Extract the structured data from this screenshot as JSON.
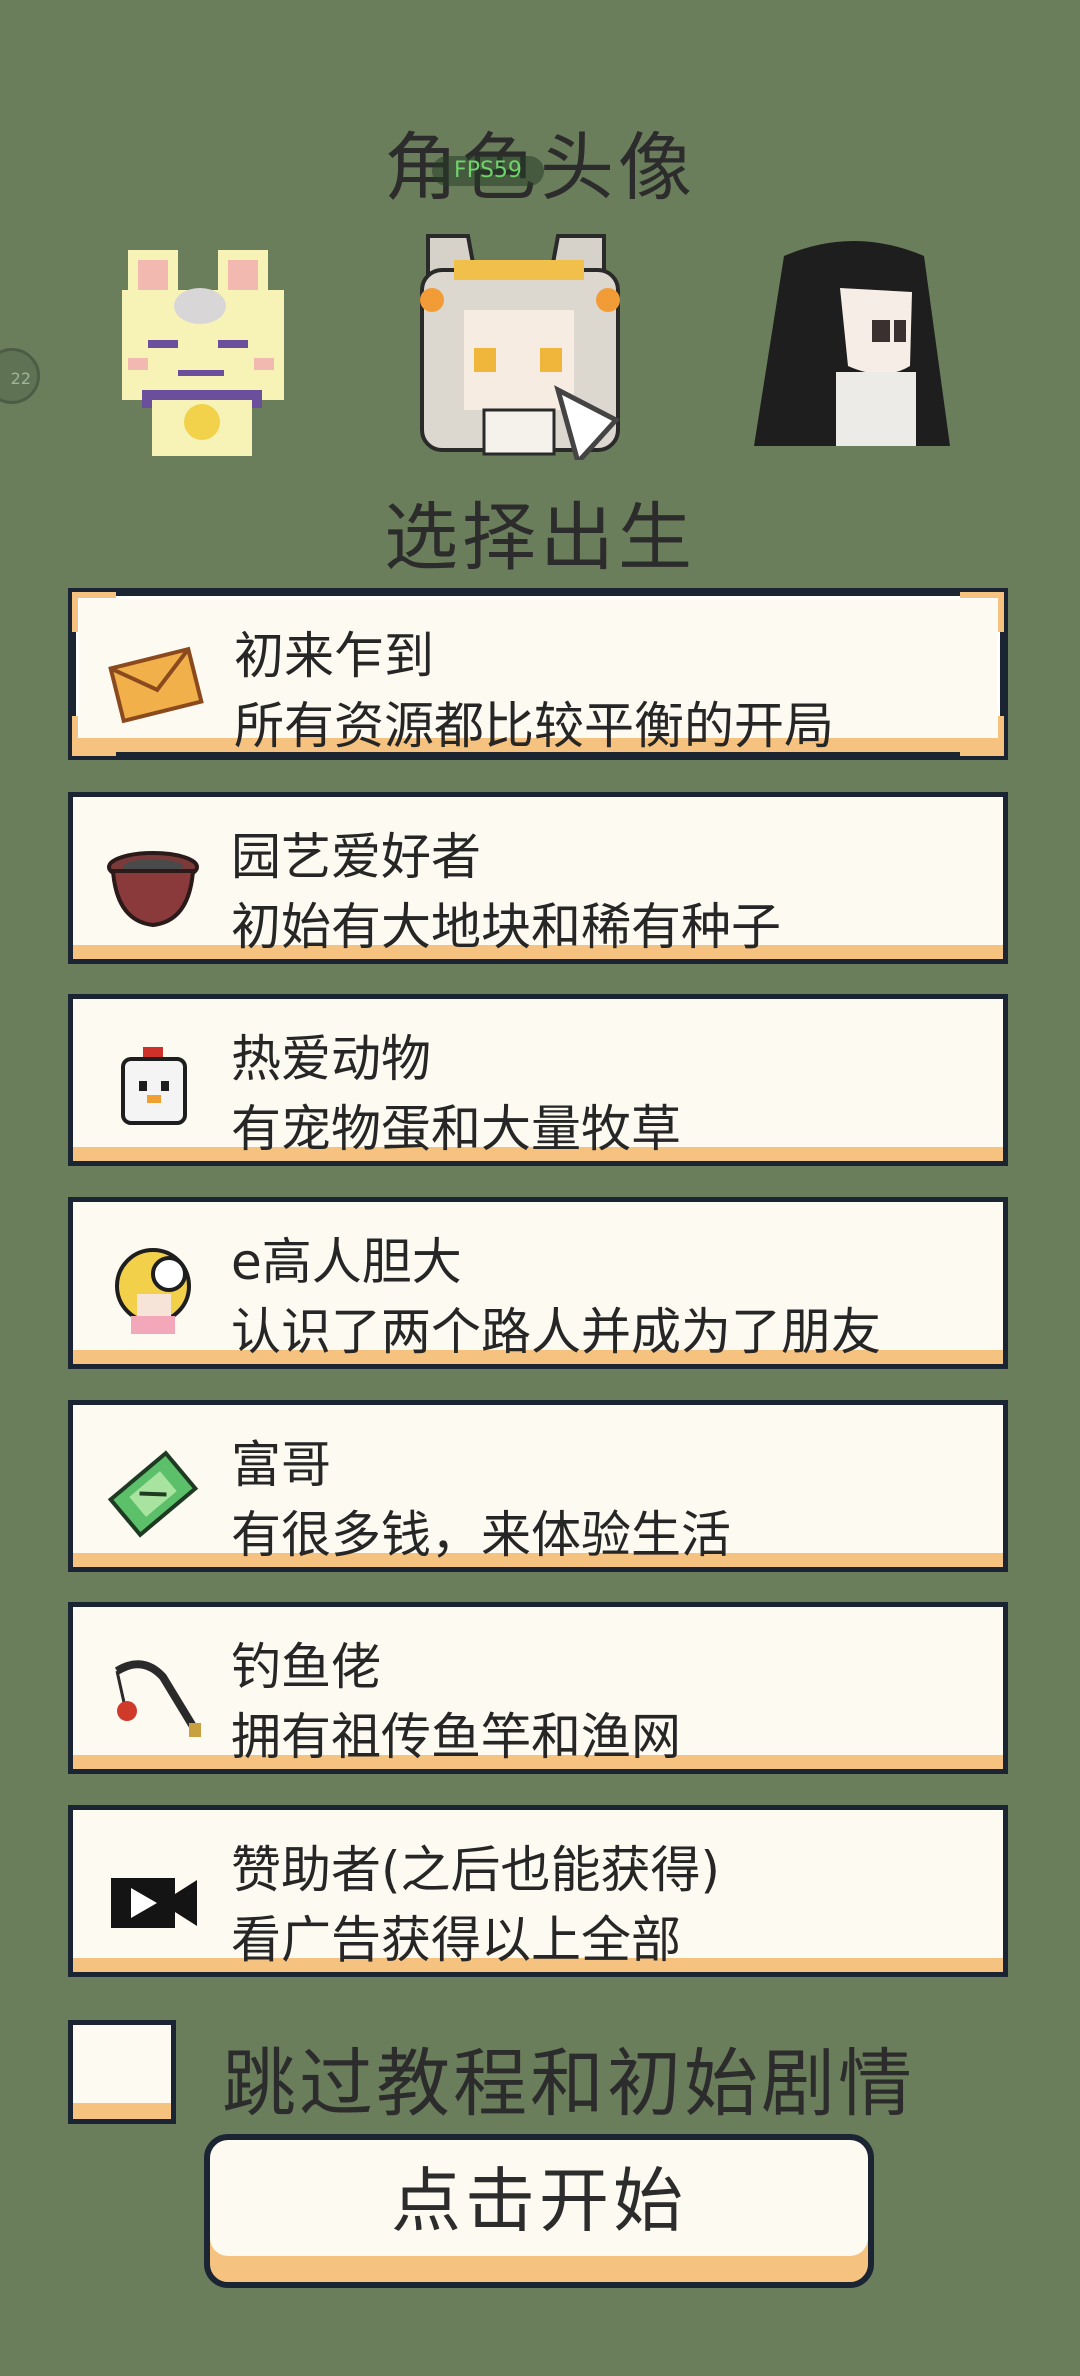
{
  "header": {
    "avatar_title": "角色头像",
    "fps": "FPS59",
    "side_badge": "22",
    "origin_title": "选择出生"
  },
  "avatars": [
    {
      "name": "yellow-bunny"
    },
    {
      "name": "silver-hair-girl",
      "selected": true
    },
    {
      "name": "black-hair-girl"
    }
  ],
  "origins": [
    {
      "title": "初来乍到",
      "desc": "所有资源都比较平衡的开局",
      "icon": "envelope-icon",
      "selected": true
    },
    {
      "title": "园艺爱好者",
      "desc": "初始有大地块和稀有种子",
      "icon": "flower-pot-icon"
    },
    {
      "title": "热爱动物",
      "desc": "有宠物蛋和大量牧草",
      "icon": "chick-icon"
    },
    {
      "title": "e高人胆大",
      "desc": "认识了两个路人并成为了朋友",
      "icon": "character-icon"
    },
    {
      "title": "富哥",
      "desc": "有很多钱，来体验生活",
      "icon": "cash-icon"
    },
    {
      "title": "钓鱼佬",
      "desc": "拥有祖传鱼竿和渔网",
      "icon": "fishing-rod-icon"
    },
    {
      "title": "赞助者(之后也能获得)",
      "desc": "看广告获得以上全部",
      "icon": "video-camera-icon"
    }
  ],
  "skip": {
    "label": "跳过教程和初始剧情",
    "checked": false
  },
  "start": {
    "label": "点击开始"
  }
}
